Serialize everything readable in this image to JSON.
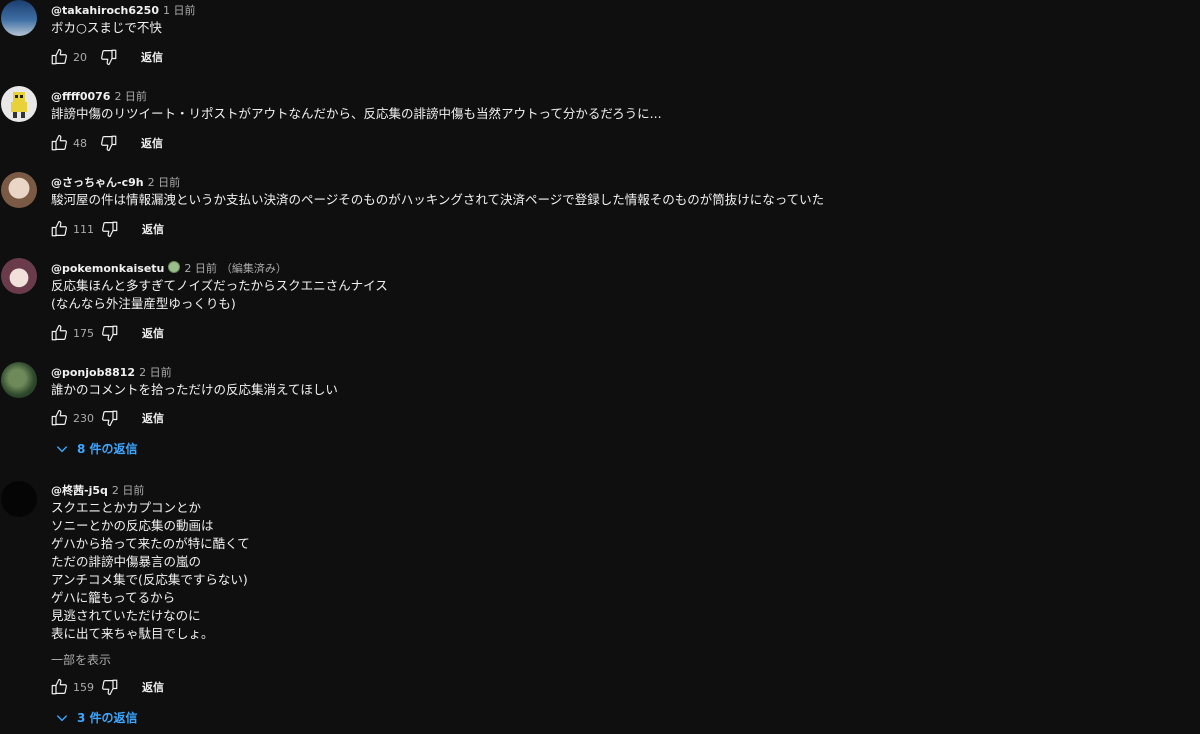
{
  "comments": [
    {
      "author": "@takahiroch6250",
      "time": "1 日前",
      "lines": [
        "ボカ○スまじで不快"
      ],
      "likes": "20",
      "reply_label": "返信"
    },
    {
      "author": "@ffff0076",
      "time": "2 日前",
      "lines": [
        "誹謗中傷のリツイート・リポストがアウトなんだから、反応集の誹謗中傷も当然アウトって分かるだろうに..."
      ],
      "likes": "48",
      "reply_label": "返信"
    },
    {
      "author": "@さっちゃん-c9h",
      "time": "2 日前",
      "lines": [
        "駿河屋の件は情報漏洩というか支払い決済のページそのものがハッキングされて決済ページで登録した情報そのものが筒抜けになっていた"
      ],
      "likes": "111",
      "reply_label": "返信"
    },
    {
      "author": "@pokemonkaisetu",
      "time": "2 日前",
      "edited": "（編集済み）",
      "lines": [
        "反応集ほんと多すぎてノイズだったからスクエニさんナイス",
        "(なんなら外注量産型ゆっくりも)"
      ],
      "likes": "175",
      "reply_label": "返信"
    },
    {
      "author": "@ponjob8812",
      "time": "2 日前",
      "lines": [
        "誰かのコメントを拾っただけの反応集消えてほしい"
      ],
      "likes": "230",
      "reply_label": "返信",
      "replies": "8 件の返信"
    },
    {
      "author": "@柊茜-j5q",
      "time": "2 日前",
      "lines": [
        "スクエニとかカプコンとか",
        "ソニーとかの反応集の動画は",
        "ゲハから拾って来たのが特に酷くて",
        "ただの誹謗中傷暴言の嵐の",
        "アンチコメ集で(反応集ですらない)",
        "ゲハに籠もってるから",
        "見逃されていただけなのに",
        "表に出て来ちゃ駄目でしょ。"
      ],
      "show_less": "一部を表示",
      "likes": "159",
      "reply_label": "返信",
      "replies": "3 件の返信"
    }
  ]
}
